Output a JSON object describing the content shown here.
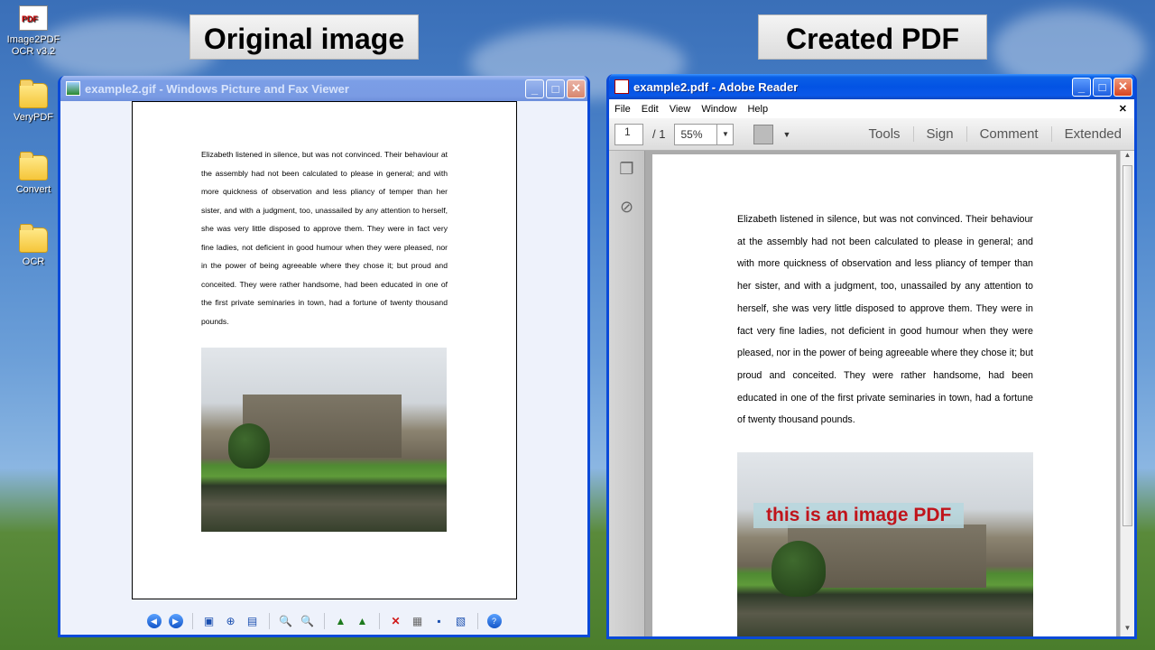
{
  "desktop": {
    "icons": [
      {
        "label": "Image2PDF\nOCR v3.2",
        "icon": "pdf-app-icon"
      },
      {
        "label": "VeryPDF",
        "icon": "folder-icon"
      },
      {
        "label": "Convert",
        "icon": "folder-icon"
      },
      {
        "label": "OCR",
        "icon": "folder-icon"
      }
    ],
    "captions": {
      "left": "Original image",
      "right": "Created PDF"
    }
  },
  "viewer": {
    "title": "example2.gif - Windows Picture and Fax Viewer",
    "paragraph": "Elizabeth listened in silence, but was not convinced. Their behaviour at the assembly had not been calculated to please in general; and with more quickness of observation and less pliancy of temper than her sister, and with a judgment, too, unassailed by any attention to herself, she was very little disposed to approve them. They were in fact very fine ladies, not deficient in good humour when they were pleased, nor in the power of being agreeable where they chose it; but proud and conceited. They were rather handsome, had been educated in one of the first private seminaries in town, had a fortune of twenty thousand pounds.",
    "toolbar": [
      "previous-image-icon",
      "next-image-icon",
      "best-fit-icon",
      "actual-size-icon",
      "slideshow-icon",
      "zoom-in-icon",
      "zoom-out-icon",
      "rotate-clockwise-icon",
      "rotate-counterclockwise-icon",
      "delete-icon",
      "print-icon",
      "save-icon",
      "edit-icon",
      "help-icon"
    ]
  },
  "reader": {
    "title": "example2.pdf - Adobe Reader",
    "menu": [
      "File",
      "Edit",
      "View",
      "Window",
      "Help"
    ],
    "page_current": "1",
    "page_total": "/ 1",
    "zoom": "55%",
    "links": [
      "Tools",
      "Sign",
      "Comment",
      "Extended"
    ],
    "overlay": "this is an image PDF"
  },
  "colors": {
    "xp_title_blue": "#0353e4",
    "overlay_text": "#c0141b"
  }
}
